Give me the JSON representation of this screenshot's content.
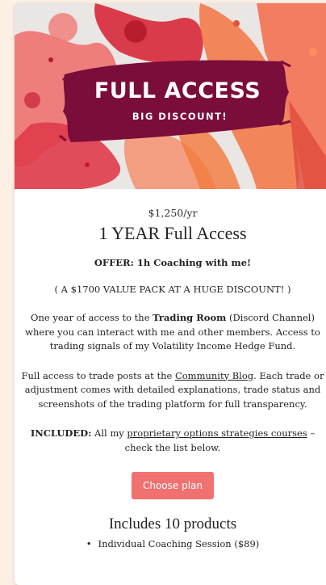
{
  "banner": {
    "title": "FULL ACCESS",
    "subtitle": "BIG DISCOUNT!"
  },
  "plan": {
    "price": "$1,250/yr",
    "title": "1 YEAR Full Access",
    "offer": "OFFER: 1h Coaching with me!",
    "value_pack": "( A $1700 VALUE PACK AT A HUGE DISCOUNT! )",
    "desc1": {
      "pre": "One year of access to the ",
      "bold": "Trading Room",
      "post": " (Discord Channel) where you can interact with me and other members. Access to trading signals of my Volatility Income Hedge Fund."
    },
    "desc2": {
      "pre": "Full access to trade posts at the ",
      "link": "Community Blog",
      "post": ". Each trade or adjustment comes with detailed explanations, trade status and screenshots of the trading platform for full transparency."
    },
    "desc3": {
      "bold": "INCLUDED:",
      "pre": " All my ",
      "link": "proprietary options strategies courses",
      "post": " – check the list below."
    },
    "cta_label": "Choose plan",
    "includes_title": "Includes 10 products",
    "products": [
      "Individual Coaching Session ($89)"
    ]
  },
  "colors": {
    "page_bg": "#fcefe3",
    "banner_bg": "#7a0d3a",
    "cta_bg": "#f07170"
  }
}
